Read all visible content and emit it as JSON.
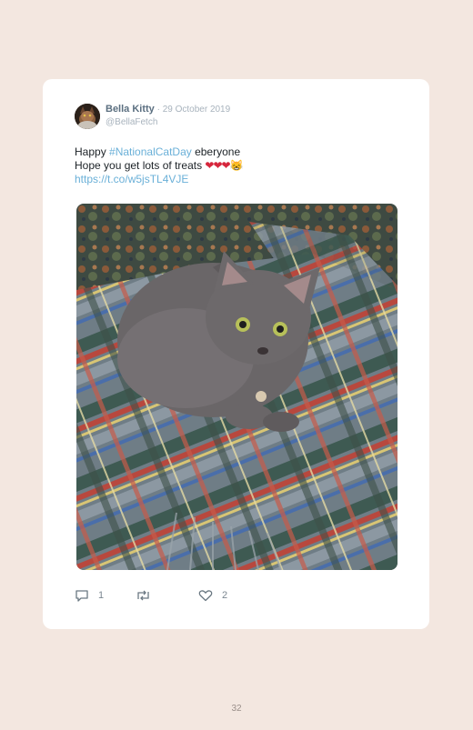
{
  "tweet": {
    "author_name": "Bella Kitty",
    "separator": " · ",
    "date": "29 October 2019",
    "handle": "@BellaFetch",
    "text_happy": "Happy ",
    "hashtag": "#NationalCatDay",
    "text_everyone": " eberyone",
    "text_line2": "Hope you get lots of treats ",
    "hearts": "❤❤❤",
    "emoji": "😸",
    "url": "https://t.co/w5jsTL4VJE",
    "replies": "1",
    "retweets": "",
    "likes": "2",
    "photo_icon": "cat-photo",
    "avatar_icon": "cat-avatar"
  },
  "page": {
    "number": "32"
  },
  "colors": {
    "background": "#f3e7e0",
    "card": "#ffffff",
    "link": "#6ab0d8",
    "name": "#5b6f80",
    "muted": "#a8b3bd"
  }
}
